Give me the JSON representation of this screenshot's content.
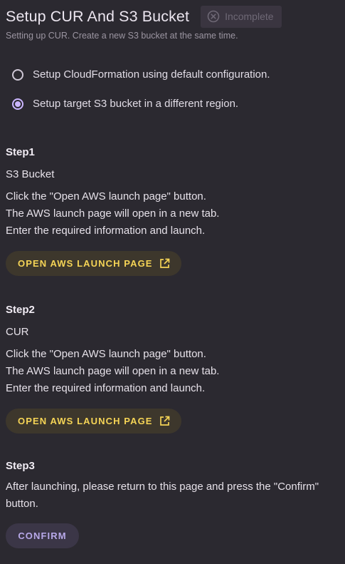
{
  "header": {
    "title": "Setup CUR And S3 Bucket",
    "status_badge": "Incomplete",
    "subtitle": "Setting up CUR. Create a new S3 bucket at the same time."
  },
  "options": [
    {
      "label": "Setup CloudFormation using default configuration.",
      "selected": false
    },
    {
      "label": "Setup target S3 bucket in a different region.",
      "selected": true
    }
  ],
  "steps": [
    {
      "title": "Step1",
      "name": "S3 Bucket",
      "lines": [
        "Click the \"Open AWS launch page\" button.",
        "The AWS launch page will open in a new tab.",
        "Enter the required information and launch."
      ],
      "button": "OPEN AWS LAUNCH PAGE"
    },
    {
      "title": "Step2",
      "name": "CUR",
      "lines": [
        "Click the \"Open AWS launch page\" button.",
        "The AWS launch page will open in a new tab.",
        "Enter the required information and launch."
      ],
      "button": "OPEN AWS LAUNCH PAGE"
    },
    {
      "title": "Step3",
      "lines": [
        "After launching, please return to this page and press the \"Confirm\"",
        "button."
      ],
      "button": "CONFIRM"
    }
  ],
  "colors": {
    "background": "#2b2930",
    "accent_yellow": "#f5d456",
    "accent_purple": "#cbb6ff"
  },
  "icons": {
    "badge": "cancel-circle-icon",
    "launch": "external-link-icon"
  }
}
